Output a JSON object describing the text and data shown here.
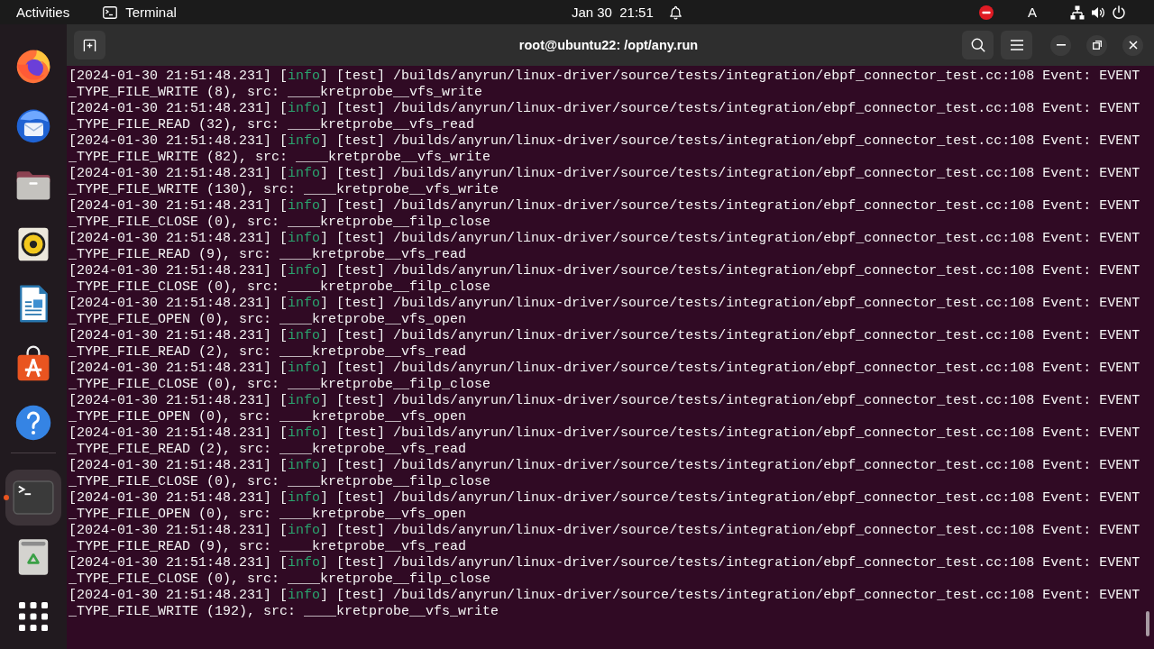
{
  "top_bar": {
    "activities": "Activities",
    "app_menu": "Terminal",
    "clock": "Jan 30  21:51",
    "input_source": "A"
  },
  "dock": {
    "favorites": [
      {
        "kind": "browser",
        "running": false,
        "selected": false
      },
      {
        "kind": "mail",
        "running": false,
        "selected": false
      },
      {
        "kind": "files",
        "running": false,
        "selected": false
      },
      {
        "kind": "music",
        "running": false,
        "selected": false
      },
      {
        "kind": "writer",
        "running": false,
        "selected": false
      },
      {
        "kind": "store",
        "running": false,
        "selected": false
      },
      {
        "kind": "help",
        "running": false,
        "selected": false
      }
    ],
    "open_apps": [
      {
        "kind": "terminal",
        "running": true,
        "selected": true
      }
    ]
  },
  "window": {
    "title": "root@ubuntu22: /opt/any.run"
  },
  "terminal": {
    "entries": [
      {
        "prefix": "[2024-01-30 21:51:48.231] [",
        "level": "info",
        "rest": "] [test] /builds/anyrun/linux-driver/source/tests/integration/ebpf_connector_test.cc:108 Event: EVENT",
        "wrap": "_TYPE_FILE_WRITE (8), src: ____kretprobe__vfs_write"
      },
      {
        "prefix": "[2024-01-30 21:51:48.231] [",
        "level": "info",
        "rest": "] [test] /builds/anyrun/linux-driver/source/tests/integration/ebpf_connector_test.cc:108 Event: EVENT",
        "wrap": "_TYPE_FILE_READ (32), src: ____kretprobe__vfs_read"
      },
      {
        "prefix": "[2024-01-30 21:51:48.231] [",
        "level": "info",
        "rest": "] [test] /builds/anyrun/linux-driver/source/tests/integration/ebpf_connector_test.cc:108 Event: EVENT",
        "wrap": "_TYPE_FILE_WRITE (82), src: ____kretprobe__vfs_write"
      },
      {
        "prefix": "[2024-01-30 21:51:48.231] [",
        "level": "info",
        "rest": "] [test] /builds/anyrun/linux-driver/source/tests/integration/ebpf_connector_test.cc:108 Event: EVENT",
        "wrap": "_TYPE_FILE_WRITE (130), src: ____kretprobe__vfs_write"
      },
      {
        "prefix": "[2024-01-30 21:51:48.231] [",
        "level": "info",
        "rest": "] [test] /builds/anyrun/linux-driver/source/tests/integration/ebpf_connector_test.cc:108 Event: EVENT",
        "wrap": "_TYPE_FILE_CLOSE (0), src: ____kretprobe__filp_close"
      },
      {
        "prefix": "[2024-01-30 21:51:48.231] [",
        "level": "info",
        "rest": "] [test] /builds/anyrun/linux-driver/source/tests/integration/ebpf_connector_test.cc:108 Event: EVENT",
        "wrap": "_TYPE_FILE_READ (9), src: ____kretprobe__vfs_read"
      },
      {
        "prefix": "[2024-01-30 21:51:48.231] [",
        "level": "info",
        "rest": "] [test] /builds/anyrun/linux-driver/source/tests/integration/ebpf_connector_test.cc:108 Event: EVENT",
        "wrap": "_TYPE_FILE_CLOSE (0), src: ____kretprobe__filp_close"
      },
      {
        "prefix": "[2024-01-30 21:51:48.231] [",
        "level": "info",
        "rest": "] [test] /builds/anyrun/linux-driver/source/tests/integration/ebpf_connector_test.cc:108 Event: EVENT",
        "wrap": "_TYPE_FILE_OPEN (0), src: ____kretprobe__vfs_open"
      },
      {
        "prefix": "[2024-01-30 21:51:48.231] [",
        "level": "info",
        "rest": "] [test] /builds/anyrun/linux-driver/source/tests/integration/ebpf_connector_test.cc:108 Event: EVENT",
        "wrap": "_TYPE_FILE_READ (2), src: ____kretprobe__vfs_read"
      },
      {
        "prefix": "[2024-01-30 21:51:48.231] [",
        "level": "info",
        "rest": "] [test] /builds/anyrun/linux-driver/source/tests/integration/ebpf_connector_test.cc:108 Event: EVENT",
        "wrap": "_TYPE_FILE_CLOSE (0), src: ____kretprobe__filp_close"
      },
      {
        "prefix": "[2024-01-30 21:51:48.231] [",
        "level": "info",
        "rest": "] [test] /builds/anyrun/linux-driver/source/tests/integration/ebpf_connector_test.cc:108 Event: EVENT",
        "wrap": "_TYPE_FILE_OPEN (0), src: ____kretprobe__vfs_open"
      },
      {
        "prefix": "[2024-01-30 21:51:48.231] [",
        "level": "info",
        "rest": "] [test] /builds/anyrun/linux-driver/source/tests/integration/ebpf_connector_test.cc:108 Event: EVENT",
        "wrap": "_TYPE_FILE_READ (2), src: ____kretprobe__vfs_read"
      },
      {
        "prefix": "[2024-01-30 21:51:48.231] [",
        "level": "info",
        "rest": "] [test] /builds/anyrun/linux-driver/source/tests/integration/ebpf_connector_test.cc:108 Event: EVENT",
        "wrap": "_TYPE_FILE_CLOSE (0), src: ____kretprobe__filp_close"
      },
      {
        "prefix": "[2024-01-30 21:51:48.231] [",
        "level": "info",
        "rest": "] [test] /builds/anyrun/linux-driver/source/tests/integration/ebpf_connector_test.cc:108 Event: EVENT",
        "wrap": "_TYPE_FILE_OPEN (0), src: ____kretprobe__vfs_open"
      },
      {
        "prefix": "[2024-01-30 21:51:48.231] [",
        "level": "info",
        "rest": "] [test] /builds/anyrun/linux-driver/source/tests/integration/ebpf_connector_test.cc:108 Event: EVENT",
        "wrap": "_TYPE_FILE_READ (9), src: ____kretprobe__vfs_read"
      },
      {
        "prefix": "[2024-01-30 21:51:48.231] [",
        "level": "info",
        "rest": "] [test] /builds/anyrun/linux-driver/source/tests/integration/ebpf_connector_test.cc:108 Event: EVENT",
        "wrap": "_TYPE_FILE_CLOSE (0), src: ____kretprobe__filp_close"
      },
      {
        "prefix": "[2024-01-30 21:51:48.231] [",
        "level": "info",
        "rest": "] [test] /builds/anyrun/linux-driver/source/tests/integration/ebpf_connector_test.cc:108 Event: EVENT",
        "wrap": "_TYPE_FILE_WRITE (192), src: ____kretprobe__vfs_write"
      }
    ]
  }
}
